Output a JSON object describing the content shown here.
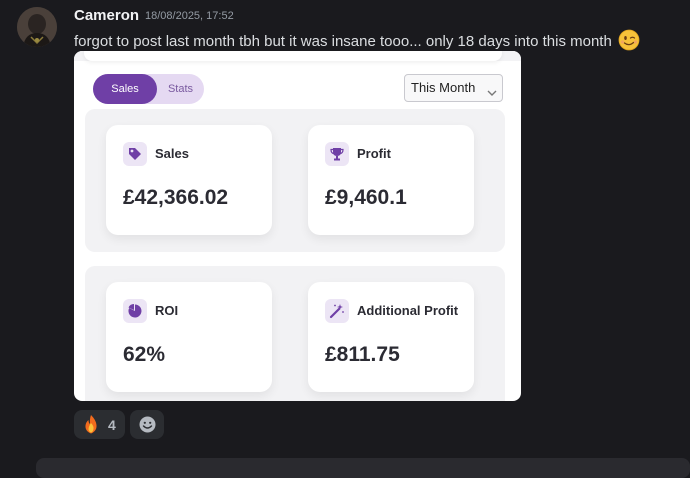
{
  "message": {
    "author": "Cameron",
    "timestamp": "18/08/2025, 17:52",
    "content": "forgot to post last month tbh but it was insane tooo... only 18 days into this month",
    "content_emoji": "winking-face"
  },
  "dashboard": {
    "toggle": {
      "options": [
        "Sales",
        "Stats"
      ],
      "active": "Sales"
    },
    "period_select": {
      "selected": "This Month"
    },
    "cards": [
      {
        "icon": "tag-icon",
        "label": "Sales",
        "value": "£42,366.02"
      },
      {
        "icon": "trophy-icon",
        "label": "Profit",
        "value": "£9,460.1"
      },
      {
        "icon": "pie-chart-icon",
        "label": "ROI",
        "value": "62%"
      },
      {
        "icon": "magic-wand-icon",
        "label": "Additional Profit",
        "value": "£811.75"
      }
    ],
    "accent": "#6f3fa6"
  },
  "reactions": [
    {
      "emoji": "fire",
      "count": "4"
    }
  ]
}
